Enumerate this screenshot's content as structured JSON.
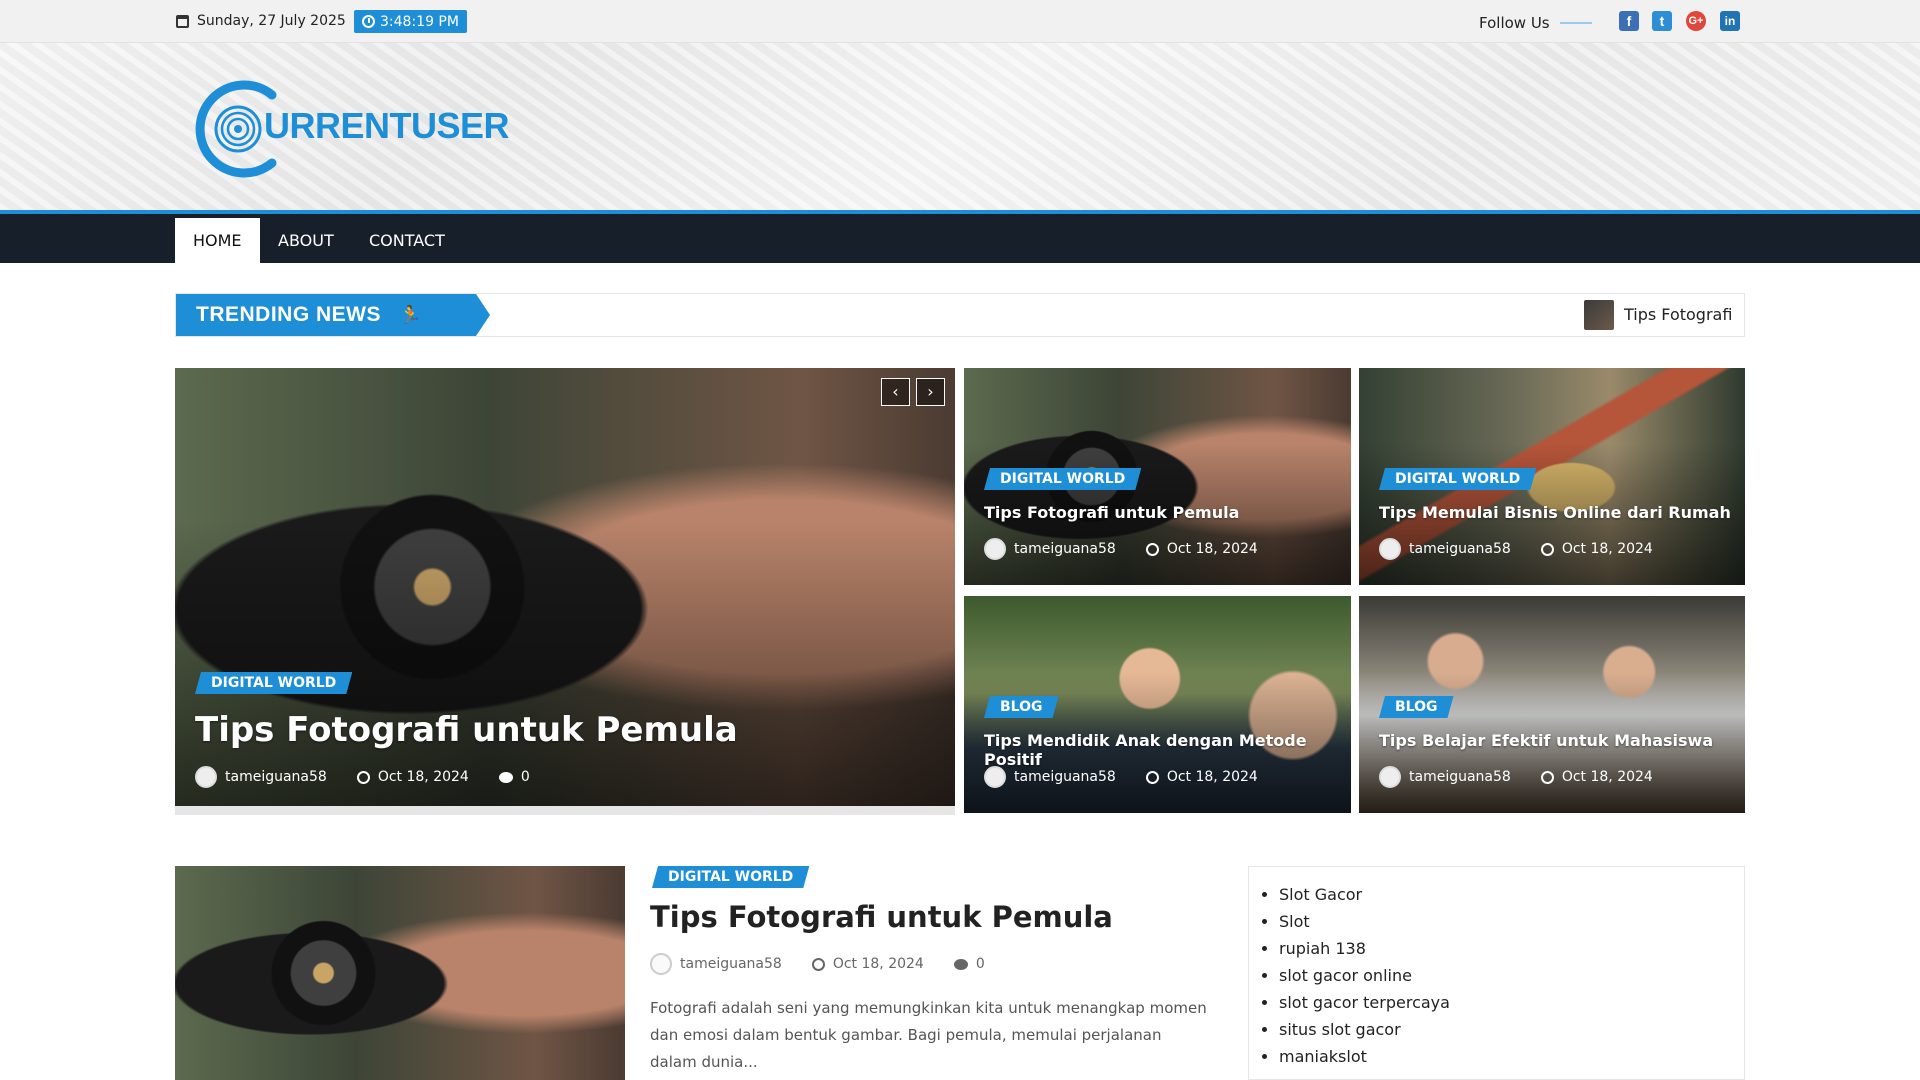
{
  "topbar": {
    "date": "Sunday, 27 July 2025",
    "time": "3:48:19 PM",
    "follow_label": "Follow Us",
    "social": [
      "facebook-icon",
      "twitter-icon",
      "google-plus-icon",
      "linkedin-icon"
    ]
  },
  "header": {
    "logo_text": "URRENTUSER"
  },
  "nav": {
    "items": [
      "HOME",
      "ABOUT",
      "CONTACT"
    ],
    "active": "HOME"
  },
  "trending": {
    "label": "TRENDING NEWS",
    "ticker_title": "Tips Fotografi"
  },
  "slider": {
    "category": "DIGITAL WORLD",
    "title": "Tips Fotografi untuk Pemula",
    "author": "tameiguana58",
    "date": "Oct 18, 2024",
    "comments": "0",
    "prev": "‹",
    "next": "›"
  },
  "grid": [
    {
      "category": "DIGITAL WORLD",
      "title": "Tips Fotografi untuk Pemula",
      "author": "tameiguana58",
      "date": "Oct 18, 2024"
    },
    {
      "category": "DIGITAL WORLD",
      "title": "Tips Memulai Bisnis Online dari Rumah",
      "author": "tameiguana58",
      "date": "Oct 18, 2024"
    },
    {
      "category": "BLOG",
      "title": "Tips Mendidik Anak dengan Metode Positif",
      "author": "tameiguana58",
      "date": "Oct 18, 2024"
    },
    {
      "category": "BLOG",
      "title": "Tips Belajar Efektif untuk Mahasiswa",
      "author": "tameiguana58",
      "date": "Oct 18, 2024"
    }
  ],
  "article": {
    "category": "DIGITAL WORLD",
    "title": "Tips Fotografi untuk Pemula",
    "author": "tameiguana58",
    "date": "Oct 18, 2024",
    "comments": "0",
    "excerpt": "Fotografi adalah seni yang memungkinkan kita untuk menangkap momen dan emosi dalam bentuk gambar. Bagi pemula, memulai perjalanan dalam dunia..."
  },
  "sidebar": {
    "links": [
      "Slot Gacor",
      "Slot",
      "rupiah 138",
      "slot gacor online",
      "slot gacor terpercaya",
      "situs slot gacor",
      "maniakslot"
    ]
  },
  "colors": {
    "accent": "#1e8fd6",
    "nav_bg": "#17202a",
    "topbar_bg": "#f1f1f1"
  }
}
